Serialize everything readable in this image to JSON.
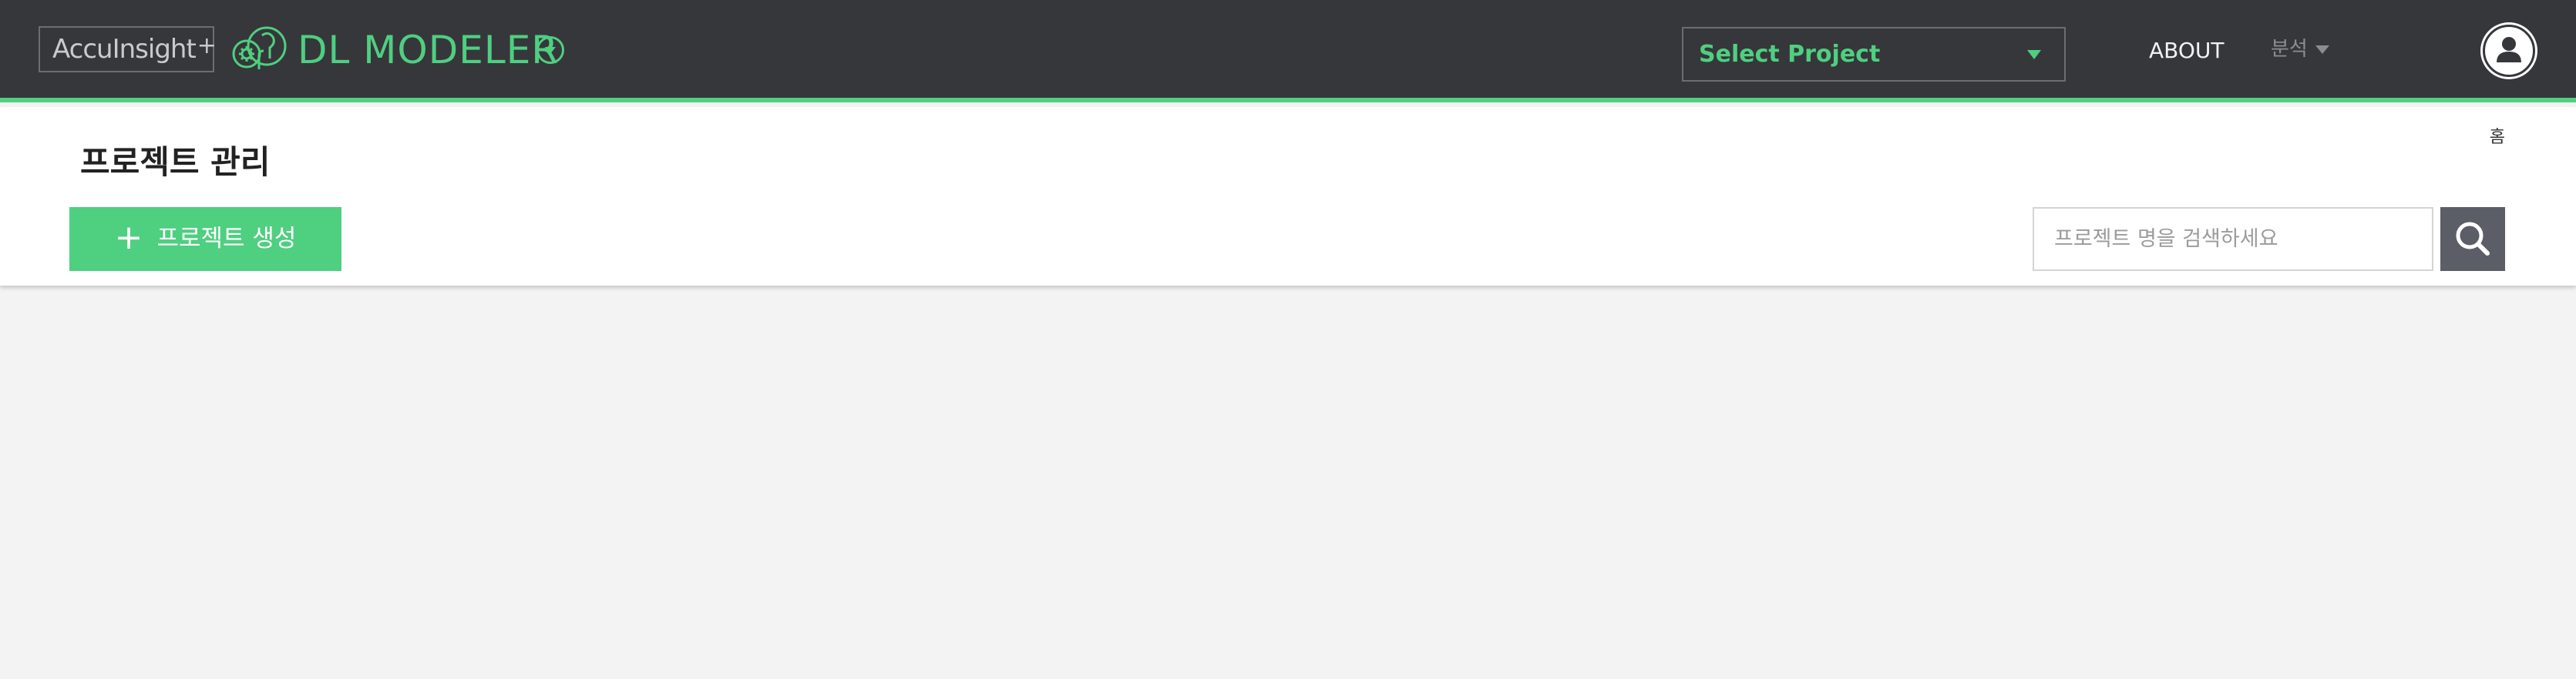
{
  "header": {
    "brand": "AccuInsight",
    "brand_plus": "+",
    "product_name": "DL MODELER",
    "project_select": "Select Project",
    "nav_about": "ABOUT",
    "nav_analysis": "분석"
  },
  "page": {
    "breadcrumb": "홈",
    "title": "프로젝트 관리",
    "create_button": "프로젝트 생성",
    "search_placeholder": "프로젝트 명을 검색하세요"
  },
  "colors": {
    "accent": "#4fcf80",
    "topbar": "#36373b",
    "search_button": "#5b5e66",
    "background": "#f3f3f3"
  },
  "icons": [
    "product-logo-icon",
    "dropdown-icon",
    "user-icon",
    "plus-icon",
    "search-icon"
  ]
}
